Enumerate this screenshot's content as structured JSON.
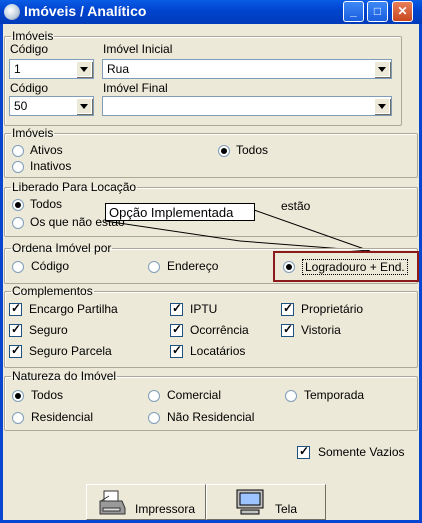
{
  "window": {
    "title": "Imóveis / Analítico"
  },
  "group_imoveis": {
    "legend": "Imóveis",
    "codigo_label": "Código",
    "codigo_value": "1",
    "imovel_inicial_label": "Imóvel Inicial",
    "imovel_inicial_value": "Rua",
    "codigo2_label": "Código",
    "codigo2_value": "50",
    "imovel_final_label": "Imóvel Final",
    "imovel_final_value": ""
  },
  "group_status": {
    "legend": "Imóveis",
    "options": [
      {
        "label": "Ativos",
        "selected": false
      },
      {
        "label": "Todos",
        "selected": true
      },
      {
        "label": "Inativos",
        "selected": false
      }
    ]
  },
  "group_liberado": {
    "legend": "Liberado Para Locação",
    "options": [
      {
        "label": "Todos",
        "selected": true
      },
      {
        "label": "Os que não estão",
        "selected": false
      },
      {
        "label": "estão",
        "selected": false
      }
    ]
  },
  "callout": {
    "text": "Opção Implementada"
  },
  "group_ordena": {
    "legend": "Ordena Imóvel por",
    "options": [
      {
        "label": "Código",
        "selected": false
      },
      {
        "label": "Endereço",
        "selected": false
      },
      {
        "label": "Logradouro + End.",
        "selected": true
      }
    ]
  },
  "group_complementos": {
    "legend": "Complementos",
    "items": [
      {
        "label": "Encargo Partilha",
        "checked": true
      },
      {
        "label": "IPTU",
        "checked": true
      },
      {
        "label": "Proprietário",
        "checked": true
      },
      {
        "label": "Seguro",
        "checked": true
      },
      {
        "label": "Ocorrência",
        "checked": true
      },
      {
        "label": "Vistoria",
        "checked": true
      },
      {
        "label": "Seguro Parcela",
        "checked": true
      },
      {
        "label": "Locatários",
        "checked": true
      }
    ]
  },
  "group_natureza": {
    "legend": "Natureza do Imóvel",
    "options": [
      {
        "label": "Todos",
        "selected": true
      },
      {
        "label": "Comercial",
        "selected": false
      },
      {
        "label": "Temporada",
        "selected": false
      },
      {
        "label": "Residencial",
        "selected": false
      },
      {
        "label": "Não Residencial",
        "selected": false
      }
    ]
  },
  "somente_vazios": {
    "label": "Somente Vazios",
    "checked": true
  },
  "buttons": {
    "impressora": "Impressora",
    "tela": "Tela"
  }
}
